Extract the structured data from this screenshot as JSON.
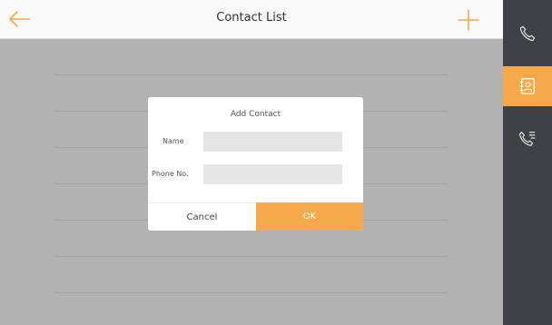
{
  "header": {
    "title": "Contact List",
    "back_icon": "arrow-left-icon",
    "add_icon": "plus-icon"
  },
  "dialog": {
    "title": "Add Contact",
    "name_label": "Name",
    "name_value": "",
    "phone_label": "Phone No.",
    "phone_value": "",
    "cancel_label": "Cancel",
    "ok_label": "OK"
  },
  "sidebar": {
    "items": [
      {
        "icon": "phone-icon",
        "active": false
      },
      {
        "icon": "contacts-icon",
        "active": true
      },
      {
        "icon": "call-log-icon",
        "active": false
      }
    ]
  },
  "colors": {
    "accent": "#f5a94b",
    "sidebar_bg": "#3f4145",
    "overlay": "rgba(0,0,0,0.28)"
  }
}
